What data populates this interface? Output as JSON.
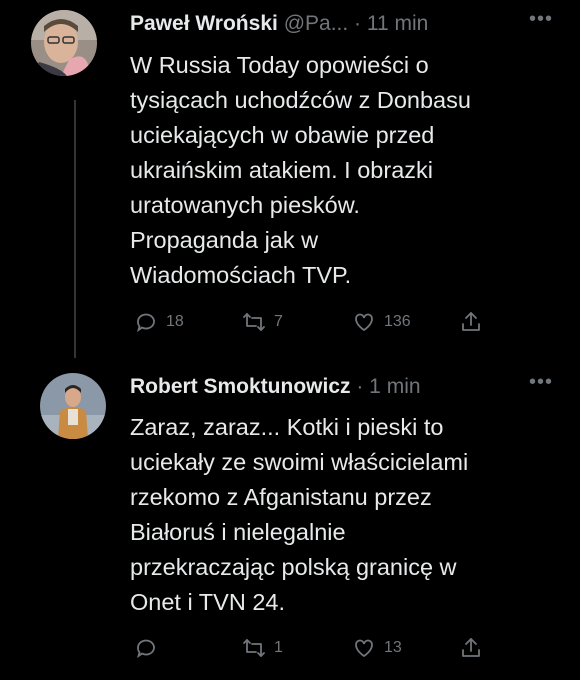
{
  "tweets": [
    {
      "display_name": "Paweł Wroński",
      "handle": "@Pa...",
      "time": "· 11 min",
      "text_lines": [
        "W Russia Today opowieści o",
        "tysiącach uchodźców z Donbasu",
        "uciekających w obawie przed",
        "ukraińskim atakiem. I obrazki",
        "uratowanych piesków.",
        "Propaganda jak w",
        "Wiadomościach TVP."
      ],
      "reply_count": "18",
      "retweet_count": "7",
      "like_count": "136",
      "icons": [
        "reply-icon",
        "retweet-icon",
        "like-icon",
        "share-icon"
      ]
    },
    {
      "display_name": "Robert Smoktunowicz",
      "handle": "",
      "time": "· 1 min",
      "text_lines": [
        "Zaraz, zaraz... Kotki i pieski to",
        "uciekały ze swoimi właścicielami",
        "rzekomo z Afganistanu przez",
        "Białoruś i nielegalnie",
        "przekraczając polską granicę w",
        "Onet i TVN 24."
      ],
      "reply_count": "",
      "retweet_count": "1",
      "like_count": "13",
      "icons": [
        "reply-icon",
        "retweet-icon",
        "like-icon",
        "share-icon"
      ]
    }
  ],
  "colors": {
    "background": "#000000",
    "text": "#e7e9ea",
    "muted": "#71767b",
    "thread_line": "#333639"
  }
}
